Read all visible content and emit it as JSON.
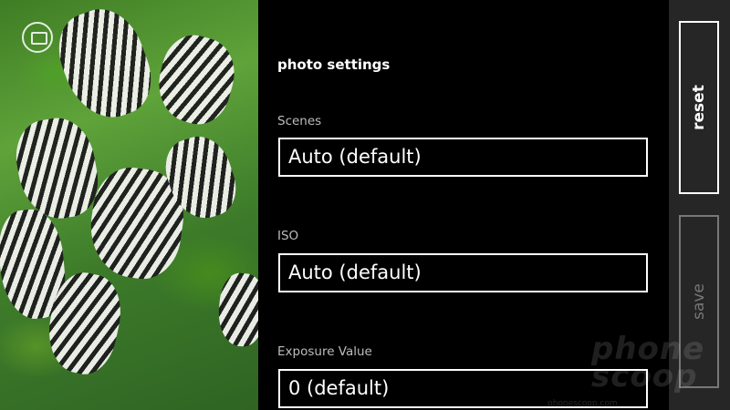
{
  "panel": {
    "title": "photo settings",
    "fields": [
      {
        "label": "Scenes",
        "value": "Auto (default)"
      },
      {
        "label": "ISO",
        "value": "Auto (default)"
      },
      {
        "label": "Exposure Value",
        "value": "0 (default)"
      }
    ]
  },
  "appbar": {
    "reset_label": "reset",
    "save_label": "save"
  },
  "watermark": {
    "text_line1": "phone",
    "text_line2": "scoop",
    "url": "phonescoop.com"
  },
  "icons": {
    "camera_switch": "camera-icon"
  },
  "colors": {
    "background": "#000000",
    "appbar": "#262626",
    "label": "#bdbdbd",
    "disabled": "#777777"
  }
}
